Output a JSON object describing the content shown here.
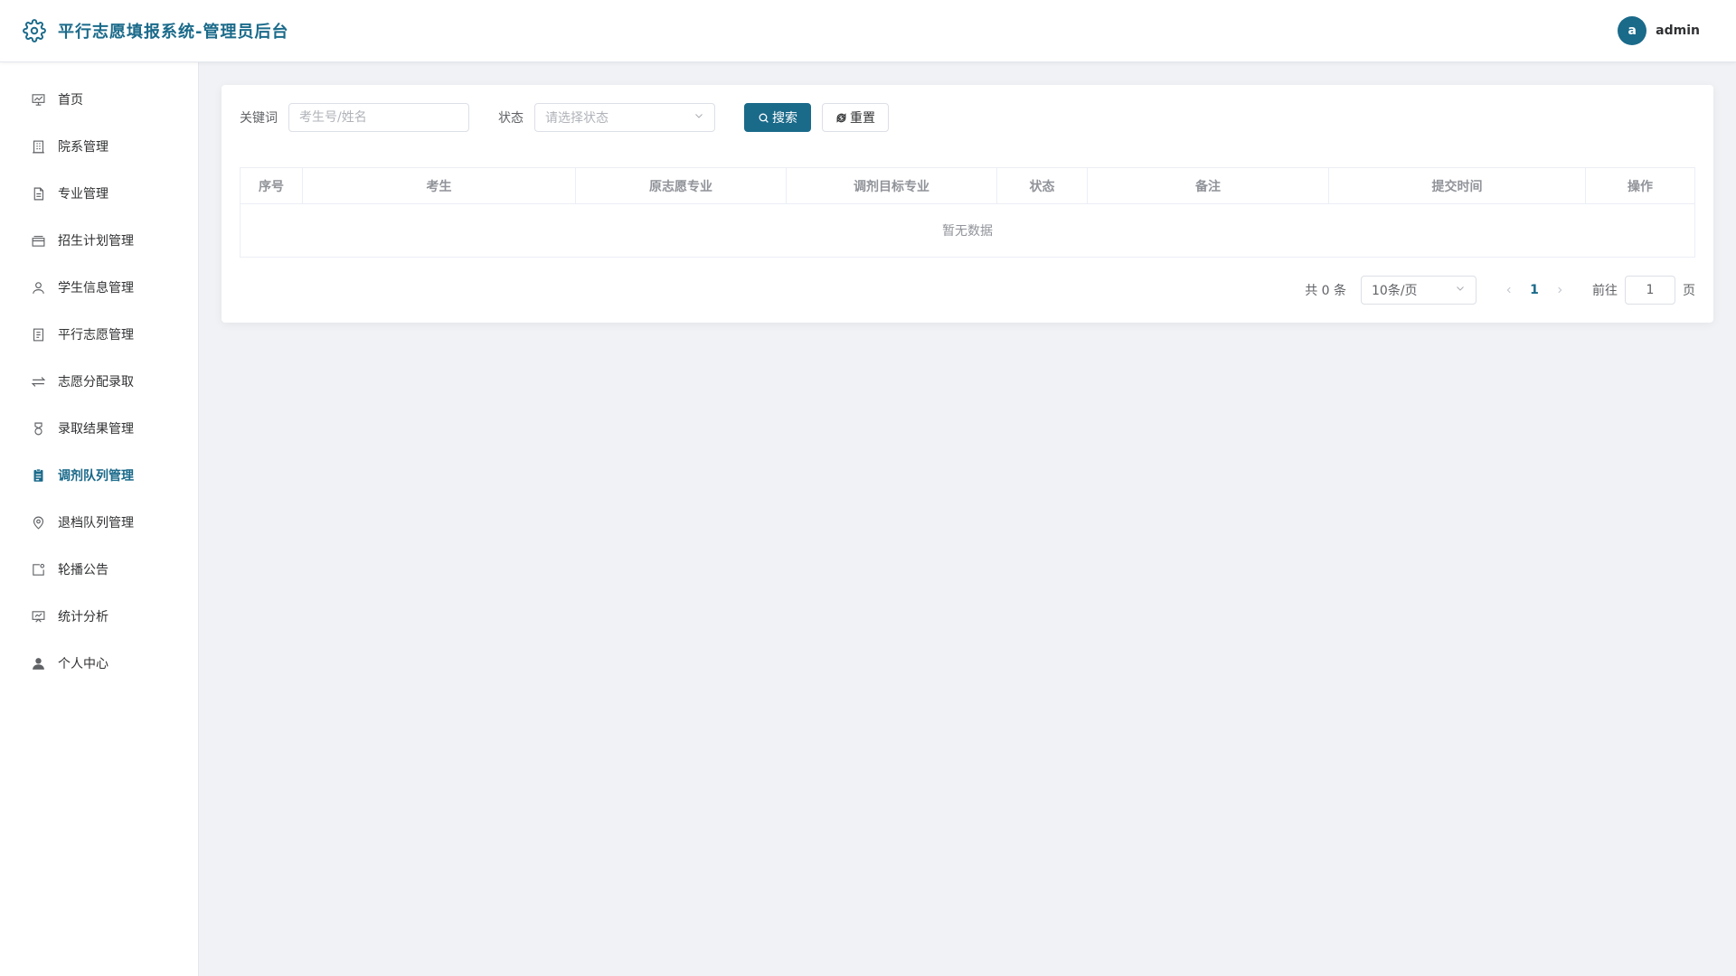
{
  "header": {
    "app_title": "平行志愿填报系统-管理员后台",
    "avatar_letter": "a",
    "username": "admin",
    "brand_color": "#1a6a8a"
  },
  "sidebar": {
    "items": [
      {
        "label": "首页",
        "icon": "chart-icon"
      },
      {
        "label": "院系管理",
        "icon": "building-icon"
      },
      {
        "label": "专业管理",
        "icon": "document-icon"
      },
      {
        "label": "招生计划管理",
        "icon": "briefcase-icon"
      },
      {
        "label": "学生信息管理",
        "icon": "user-icon"
      },
      {
        "label": "平行志愿管理",
        "icon": "tickets-icon"
      },
      {
        "label": "志愿分配录取",
        "icon": "sort-icon"
      },
      {
        "label": "录取结果管理",
        "icon": "medal-icon"
      },
      {
        "label": "调剂队列管理",
        "icon": "notebook-icon",
        "active": true
      },
      {
        "label": "退档队列管理",
        "icon": "location-icon"
      },
      {
        "label": "轮播公告",
        "icon": "picture-icon"
      },
      {
        "label": "统计分析",
        "icon": "data-board-icon"
      },
      {
        "label": "个人中心",
        "icon": "user-filled-icon"
      }
    ]
  },
  "filters": {
    "keyword_label": "关键词",
    "keyword_placeholder": "考生号/姓名",
    "status_label": "状态",
    "status_placeholder": "请选择状态",
    "search_label": "搜索",
    "reset_label": "重置"
  },
  "table": {
    "columns": [
      "序号",
      "考生",
      "原志愿专业",
      "调剂目标专业",
      "状态",
      "备注",
      "提交时间",
      "操作"
    ],
    "empty_text": "暂无数据"
  },
  "pagination": {
    "total_text": "共 0 条",
    "page_size": "10条/页",
    "current_page": "1",
    "goto_label": "前往",
    "goto_value": "1",
    "page_suffix": "页"
  }
}
